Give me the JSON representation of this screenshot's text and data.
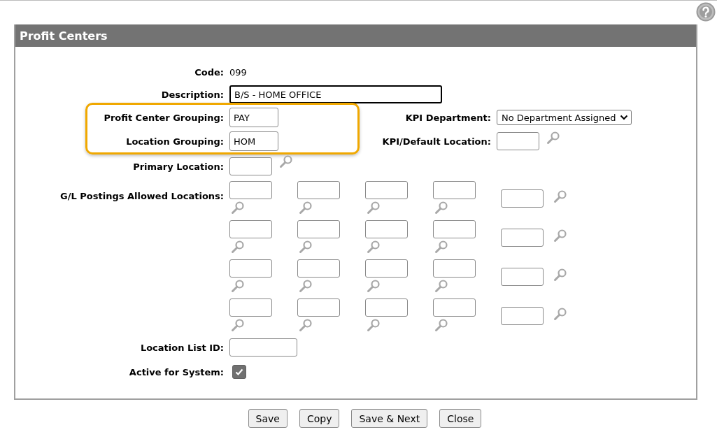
{
  "header": {
    "title": "Profit Centers"
  },
  "code": {
    "label": "Code:",
    "value": "099"
  },
  "description": {
    "label": "Description:",
    "value": "B/S - HOME OFFICE",
    "focused": true
  },
  "grouping": {
    "highlighted": true,
    "profit_center": {
      "label": "Profit Center Grouping:",
      "value": "PAY"
    },
    "location": {
      "label": "Location Grouping:",
      "value": "HOM"
    }
  },
  "kpi_department": {
    "label": "KPI Department:",
    "value": "No Department Assigned"
  },
  "kpi_default_location": {
    "label": "KPI/Default Location:"
  },
  "primary_location": {
    "label": "Primary Location:"
  },
  "gl_postings": {
    "label": "G/L Postings Allowed Locations:"
  },
  "location_list_id": {
    "label": "Location List ID:"
  },
  "active_for_system": {
    "label": "Active for System:",
    "checked": true
  },
  "buttons": [
    "Save",
    "Copy",
    "Save & Next",
    "Close"
  ]
}
